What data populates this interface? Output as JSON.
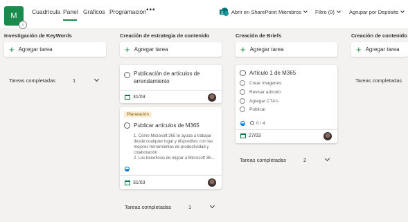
{
  "app": {
    "icon_letter": "M"
  },
  "nav": {
    "tabs": [
      "Cuadrícula",
      "Panel",
      "Gráficos",
      "Programación"
    ],
    "active_tab": "Panel",
    "more": "•••"
  },
  "toolbar": {
    "sharepoint": "Abrir en SharePoint",
    "members": "Miembros",
    "filter": "Filtro (0)",
    "group_by": "Agrupar por Depósito"
  },
  "columns": [
    {
      "title": "Investigación de KeyWords",
      "add_label": "Agregar tarea",
      "completed_label": "Tareas completadas",
      "completed_count": "1"
    },
    {
      "title": "Creación de estrategia de contenido",
      "add_label": "Agregar tarea",
      "completed_label": "Tareas completadas",
      "completed_count": "1",
      "cards": [
        {
          "title": "Publicación de artículos de arrendamiento",
          "date": "31/03"
        },
        {
          "label": "Planeación",
          "title": "Publicar artículos de M365",
          "description": "1. Cómo Microsoft 365 te ayuda a trabajar desde cualquier lugar y dispositivo; con las mejores herramientas de productividad y colaboración.\n2. Los beneficios de migrar a Microsoft 36...",
          "date": "31/03"
        }
      ]
    },
    {
      "title": "Creación de Briefs",
      "add_label": "Agregar tarea",
      "completed_label": "Tareas completadas",
      "completed_count": "2",
      "cards": [
        {
          "title": "Artículo 1 de M365",
          "checklist": [
            "Crear imagenes",
            "Revisar artículo",
            "Agregar CTA's",
            "Publicar"
          ],
          "progress": "0 / 4",
          "date": "27/03"
        }
      ]
    },
    {
      "title": "Creación de contenido",
      "add_label": "Agregar tarea",
      "completed_label": "Tareas completadas"
    }
  ]
}
